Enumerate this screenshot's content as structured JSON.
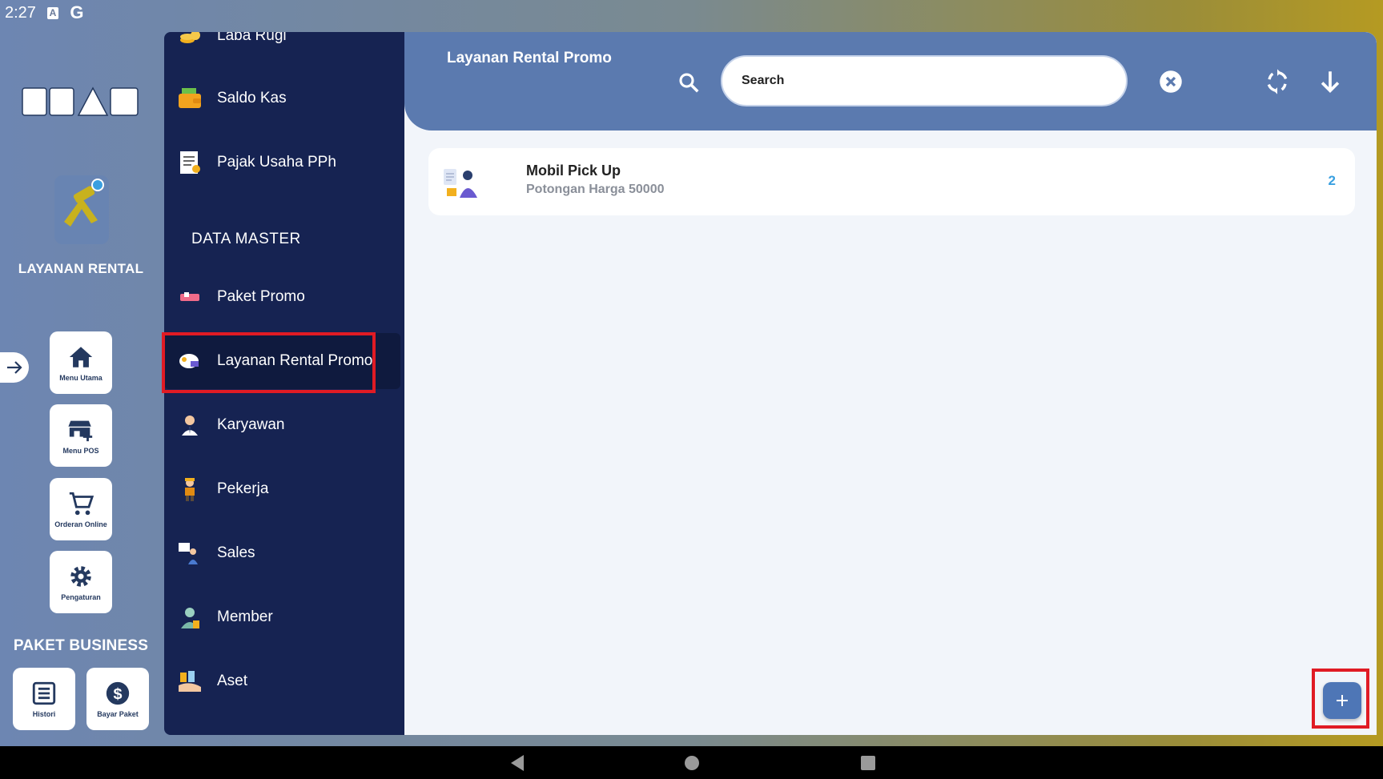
{
  "status_bar": {
    "time": "2:27"
  },
  "rail": {
    "app_title": "LAYANAN RENTAL",
    "buttons": [
      {
        "label": "Menu Utama",
        "icon": "home-icon"
      },
      {
        "label": "Menu POS",
        "icon": "store-icon"
      },
      {
        "label": "Orderan Online",
        "icon": "cart-icon"
      },
      {
        "label": "Pengaturan",
        "icon": "gear-icon"
      }
    ],
    "paket_title": "PAKET BUSINESS",
    "paket_buttons": [
      {
        "label": "Histori",
        "icon": "list-icon"
      },
      {
        "label": "Bayar Paket",
        "icon": "dollar-icon"
      }
    ]
  },
  "sidebar": {
    "items_top": [
      {
        "label": "Laba Rugi",
        "icon": "coins-icon"
      },
      {
        "label": "Saldo Kas",
        "icon": "wallet-icon"
      },
      {
        "label": "Pajak Usaha PPh",
        "icon": "tax-document-icon"
      }
    ],
    "section_title": "DATA MASTER",
    "items": [
      {
        "label": "Paket Promo",
        "icon": "promo-icon"
      },
      {
        "label": "Layanan Rental Promo",
        "icon": "rental-promo-icon"
      },
      {
        "label": "Karyawan",
        "icon": "employee-icon"
      },
      {
        "label": "Pekerja",
        "icon": "worker-icon"
      },
      {
        "label": "Sales",
        "icon": "sales-icon"
      },
      {
        "label": "Member",
        "icon": "member-icon"
      },
      {
        "label": "Aset",
        "icon": "asset-icon"
      }
    ]
  },
  "header": {
    "title": "Layanan Rental Promo",
    "search_placeholder": "Search"
  },
  "list": [
    {
      "title": "Mobil Pick Up",
      "subtitle": "Potongan Harga 50000",
      "count": "2"
    }
  ],
  "colors": {
    "sidebar_bg": "#162352",
    "header_bg": "#5b7aaf",
    "accent_count": "#3aa0e0",
    "highlight": "#e01b24",
    "fab_bg": "#4e76b6"
  }
}
